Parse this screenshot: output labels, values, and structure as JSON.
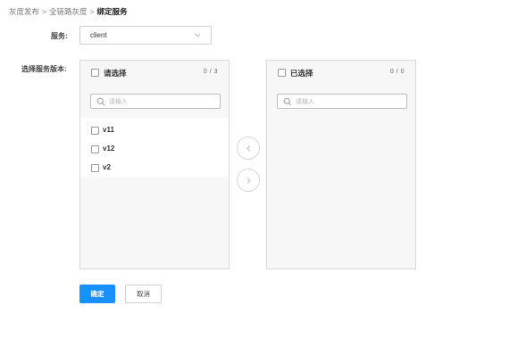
{
  "breadcrumb": {
    "items": [
      "灰度发布",
      "全链路灰度",
      "绑定服务"
    ],
    "separator": ">"
  },
  "form": {
    "service_label": "服务:",
    "service_value": "client",
    "versions_label": "选择服务版本:"
  },
  "transfer": {
    "left": {
      "title": "请选择",
      "count": "0 / 3",
      "search_placeholder": "请输入",
      "items": [
        {
          "label": "v11"
        },
        {
          "label": "v12"
        },
        {
          "label": "v2"
        }
      ]
    },
    "right": {
      "title": "已选择",
      "count": "0 / 0",
      "search_placeholder": "请输入",
      "items": []
    },
    "move_left_icon": "chevron-left-icon",
    "move_right_icon": "chevron-right-icon"
  },
  "actions": {
    "confirm_label": "确定",
    "cancel_label": "取消"
  },
  "colors": {
    "primary": "#1890ff",
    "panel_bg": "#f7f7f7",
    "border": "#d9d9d9"
  }
}
